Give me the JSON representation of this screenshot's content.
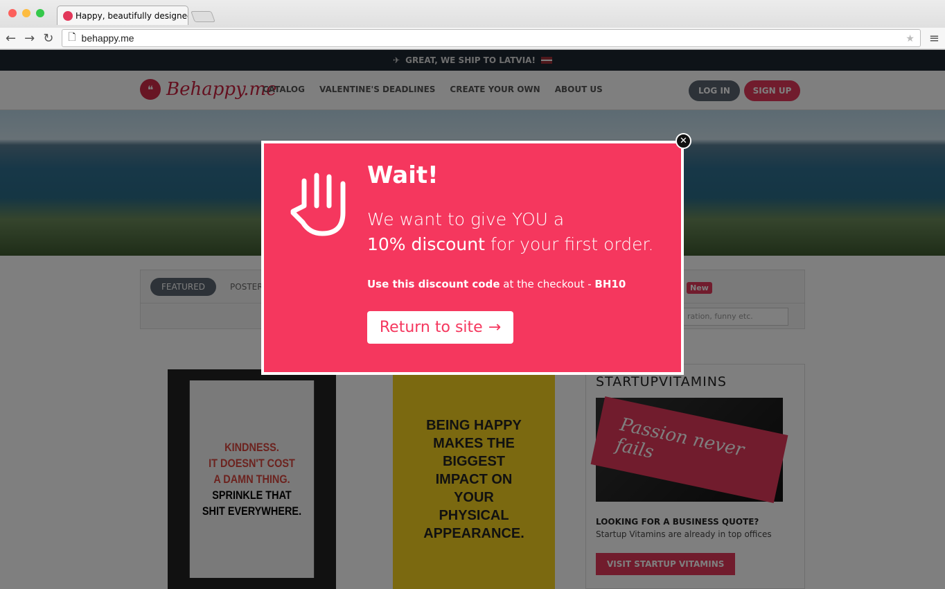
{
  "browser": {
    "tab_title": "Happy, beautifully designed",
    "url": "behappy.me"
  },
  "shipbar": {
    "text": "GREAT, WE SHIP TO LATVIA!"
  },
  "header": {
    "logo": "Behappy.me",
    "menu": [
      "CATALOG",
      "VALENTINE'S DEADLINES",
      "CREATE YOUR OWN",
      "ABOUT US"
    ],
    "login": "LOG IN",
    "signup": "SIGN UP"
  },
  "filters": {
    "tabs": [
      "FEATURED",
      "POSTERS"
    ],
    "badge": "New",
    "search_placeholder": "ration, funny etc."
  },
  "posters": {
    "p1_red": [
      "KINDNESS.",
      "IT DOESN'T COST",
      "A DAMN THING."
    ],
    "p1_black": [
      "SPRINKLE THAT",
      "SHIT EVERYWHERE."
    ],
    "p2": [
      "BEING HAPPY",
      "MAKES THE",
      "BIGGEST",
      "IMPACT ON",
      "YOUR",
      "PHYSICAL",
      "APPEARANCE."
    ]
  },
  "startup": {
    "title": "STARTUPVITAMINS",
    "image_text": "Passion never fails",
    "question": "LOOKING FOR A BUSINESS QUOTE?",
    "subtitle": "Startup Vitamins are already in top offices",
    "button": "VISIT STARTUP VITAMINS"
  },
  "modal": {
    "title": "Wait!",
    "line1": "We want to give YOU a",
    "line2_bold": "10% discount",
    "line2_rest": " for your first order.",
    "code_bold": "Use this discount code",
    "code_mid": " at the checkout - ",
    "code": "BH10",
    "button": "Return to site"
  },
  "colors": {
    "accent": "#f5375e",
    "dark": "#1d2630"
  }
}
